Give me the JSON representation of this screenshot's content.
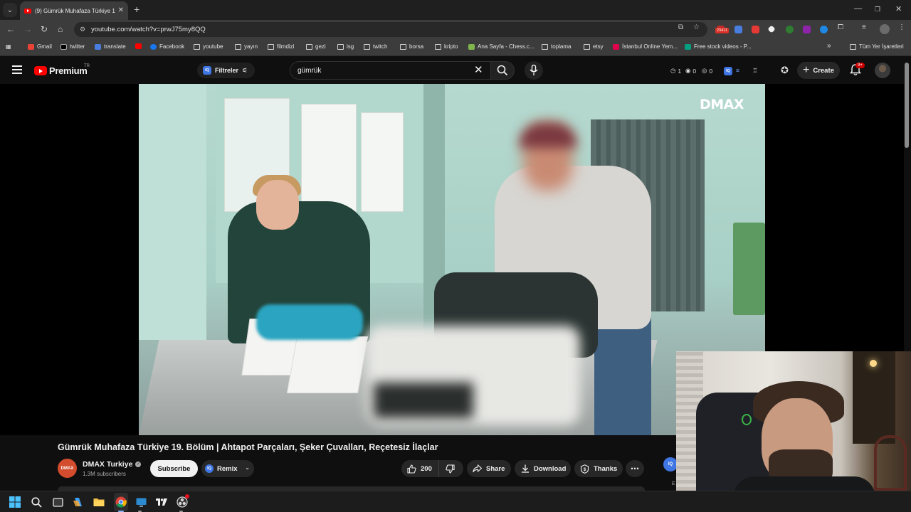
{
  "browser": {
    "tab_title": "(9) Gümrük Muhafaza Türkiye 1",
    "url": "youtube.com/watch?v=prwJ75my8QQ",
    "ext_badge": "23411",
    "bookmarks": [
      {
        "label": "Gmail",
        "icon": "gmail-icon"
      },
      {
        "label": "twitter",
        "icon": "x-icon"
      },
      {
        "label": "translate",
        "icon": "translate-icon"
      },
      {
        "label": "",
        "icon": "youtube-icon"
      },
      {
        "label": "Facebook",
        "icon": "facebook-icon"
      },
      {
        "label": "youtube",
        "icon": "folder-icon"
      },
      {
        "label": "yayın",
        "icon": "folder-icon"
      },
      {
        "label": "filmdizi",
        "icon": "folder-icon"
      },
      {
        "label": "gezi",
        "icon": "folder-icon"
      },
      {
        "label": "isg",
        "icon": "folder-icon"
      },
      {
        "label": "twitch",
        "icon": "folder-icon"
      },
      {
        "label": "borsa",
        "icon": "folder-icon"
      },
      {
        "label": "kripto",
        "icon": "folder-icon"
      },
      {
        "label": "Ana Sayfa - Chess.c...",
        "icon": "chess-icon"
      },
      {
        "label": "toplama",
        "icon": "folder-icon"
      },
      {
        "label": "etsy",
        "icon": "folder-icon"
      },
      {
        "label": "İstanbul Online Yem...",
        "icon": "yemeksepeti-icon"
      },
      {
        "label": "Free stock videos - P...",
        "icon": "pexels-icon"
      }
    ],
    "bookmarks_overflow": "»",
    "all_bookmarks": "Tüm Yer İşaretleri"
  },
  "youtube": {
    "logo_text": "Premium",
    "region": "TR",
    "filters_label": "Filtreler",
    "search_query": "gümrük",
    "counters": [
      "1",
      "0",
      "0"
    ],
    "create_label": "Create",
    "notifications": "9+"
  },
  "video": {
    "watermark": "DMAX",
    "title": "Gümrük Muhafaza Türkiye 19. Bölüm | Ahtapot Parçaları, Şeker Çuvalları, Reçetesiz İlaçlar",
    "channel_avatar_text": "DMAX",
    "channel": "DMAX Turkiye",
    "subscribers": "1.3M subscribers",
    "subscribe_label": "Subscribe",
    "remix_label": "Remix",
    "likes": "200",
    "share_label": "Share",
    "download_label": "Download",
    "thanks_label": "Thanks",
    "side_iq": "IQ",
    "side_label": "E"
  },
  "colors": {
    "youtube_red": "#ff0000",
    "iq_blue": "#3f76e4",
    "background": "#0f0f0f"
  }
}
